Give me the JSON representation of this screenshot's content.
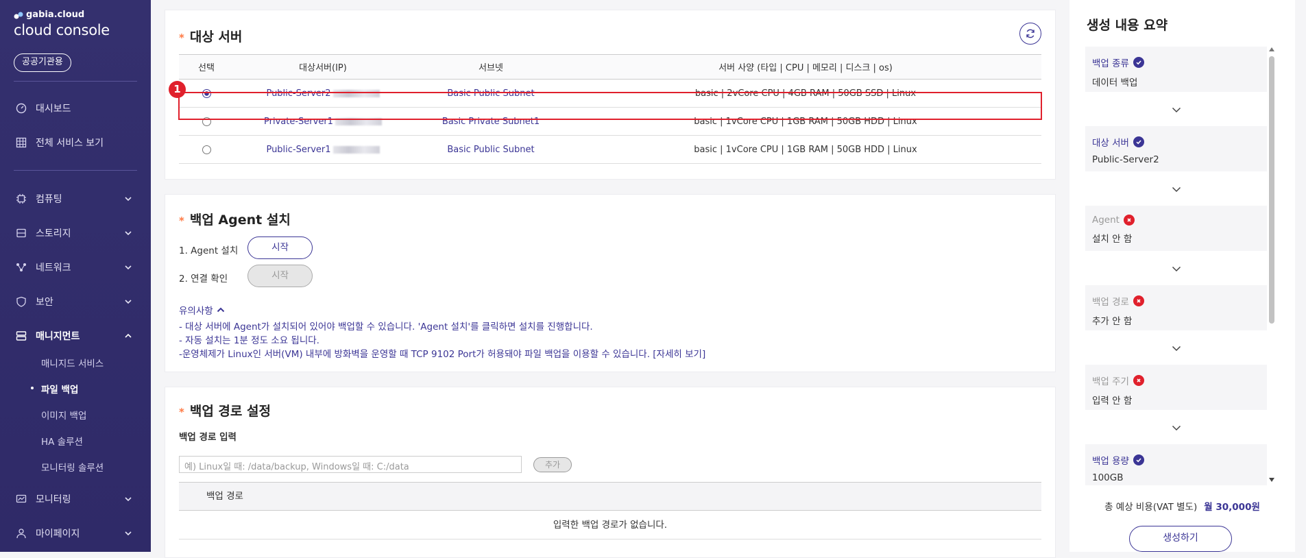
{
  "sidebar": {
    "brand_top": "gabia.cloud",
    "brand_main": "cloud console",
    "public_btn": "공공기관용",
    "nav": [
      {
        "label": "대시보드"
      },
      {
        "label": "전체 서비스 보기"
      },
      {
        "label": "컴퓨팅"
      },
      {
        "label": "스토리지"
      },
      {
        "label": "네트워크"
      },
      {
        "label": "보안"
      },
      {
        "label": "매니지먼트"
      },
      {
        "label": "모니터링"
      },
      {
        "label": "마이페이지"
      }
    ],
    "sub": [
      "매니지드 서비스",
      "파일 백업",
      "이미지 백업",
      "HA 솔루션",
      "모니터링 솔루션"
    ]
  },
  "server_section": {
    "title": "대상 서버",
    "badge": "1",
    "headers": [
      "선택",
      "대상서버(IP)",
      "서브넷",
      "서버 사양 (타입 | CPU | 메모리 | 디스크 | os)"
    ],
    "rows": [
      {
        "name": "Public-Server2",
        "subnet": "Basic Public Subnet",
        "spec": "basic | 2vCore CPU | 4GB RAM | 50GB SSD | Linux"
      },
      {
        "name": "Private-Server1",
        "subnet": "Basic Private Subnet1",
        "spec": "basic | 1vCore CPU | 1GB RAM | 50GB HDD | Linux"
      },
      {
        "name": "Public-Server1",
        "subnet": "Basic Public Subnet",
        "spec": "basic | 1vCore CPU | 1GB RAM | 50GB HDD | Linux"
      }
    ]
  },
  "agent_section": {
    "title": "백업 Agent 설치",
    "step1": "1. Agent 설치",
    "step2": "2. 연결 확인",
    "start": "시작",
    "notice_title": "유의사항",
    "notices": [
      "- 대상 서버에 Agent가 설치되어 있어야 백업할 수 있습니다. 'Agent 설치'를 클릭하면 설치를 진행합니다.",
      "- 자동 설치는 1분 정도 소요 됩니다.",
      "-운영체제가 Linux인 서버(VM) 내부에 방화벽을 운영할 때 TCP 9102 Port가 허용돼야 파일 백업을 이용할 수 있습니다. [자세히 보기]"
    ]
  },
  "path_section": {
    "title": "백업 경로 설정",
    "input_label": "백업 경로 입력",
    "placeholder": "예) Linux일 때: /data/backup, Windows일 때: C:/data",
    "add": "추가",
    "col": "백업 경로",
    "empty": "입력한 백업 경로가 없습니다."
  },
  "summary": {
    "title": "생성 내용 요약",
    "items": [
      {
        "key": "백업 종류",
        "value": "데이터 백업",
        "ok": true
      },
      {
        "key": "대상 서버",
        "value": "Public-Server2",
        "ok": true
      },
      {
        "key": "Agent",
        "value": "설치 안 함",
        "ok": false
      },
      {
        "key": "백업 경로",
        "value": "추가 안 함",
        "ok": false
      },
      {
        "key": "백업 주기",
        "value": "입력 안 함",
        "ok": false
      },
      {
        "key": "백업 용량",
        "value": "100GB",
        "ok": true
      }
    ],
    "cost_label": "총 예상 비용(VAT 별도)",
    "cost_value": "월 30,000원",
    "create": "생성하기"
  },
  "colors": {
    "accent": "#3b3595",
    "sidebar": "#34306e",
    "error": "#e0202c"
  }
}
